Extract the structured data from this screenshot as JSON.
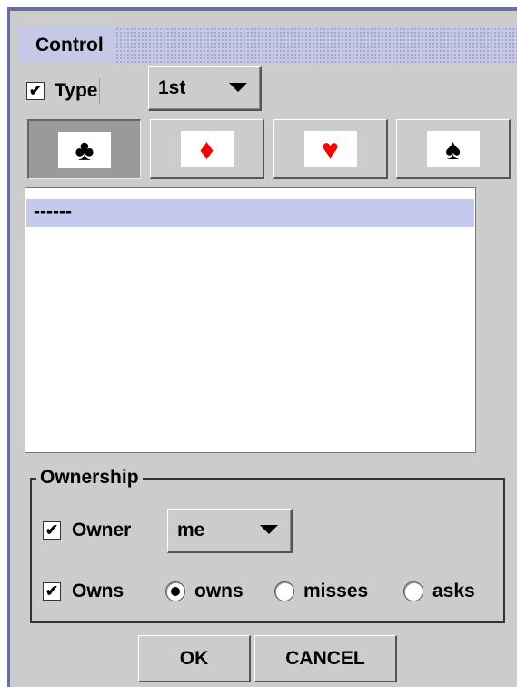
{
  "window": {
    "title": "Control"
  },
  "type_filter": {
    "checked": true,
    "checkbox_mark": "✔",
    "label": "Type",
    "selected": "1st"
  },
  "suits": [
    {
      "name": "clubs",
      "glyph": "♣",
      "color": "#000000",
      "pressed": true
    },
    {
      "name": "diamonds",
      "glyph": "♦",
      "color": "#ff0000",
      "pressed": false
    },
    {
      "name": "hearts",
      "glyph": "♥",
      "color": "#ff0000",
      "pressed": false
    },
    {
      "name": "spades",
      "glyph": "♠",
      "color": "#000000",
      "pressed": false
    }
  ],
  "card_list": {
    "items": [
      "------"
    ],
    "selected_index": 0
  },
  "ownership": {
    "title": "Ownership",
    "owner": {
      "checked": true,
      "label": "Owner",
      "selected": "me"
    },
    "owns": {
      "checked": true,
      "label": "Owns",
      "options": [
        {
          "label": "owns",
          "selected": true
        },
        {
          "label": "misses",
          "selected": false
        },
        {
          "label": "asks",
          "selected": false
        }
      ]
    }
  },
  "buttons": {
    "ok": "OK",
    "cancel": "CANCEL"
  },
  "colors": {
    "panel": "#cccccc",
    "selection": "#c6c9ee",
    "accent": "#6a6f9a"
  }
}
